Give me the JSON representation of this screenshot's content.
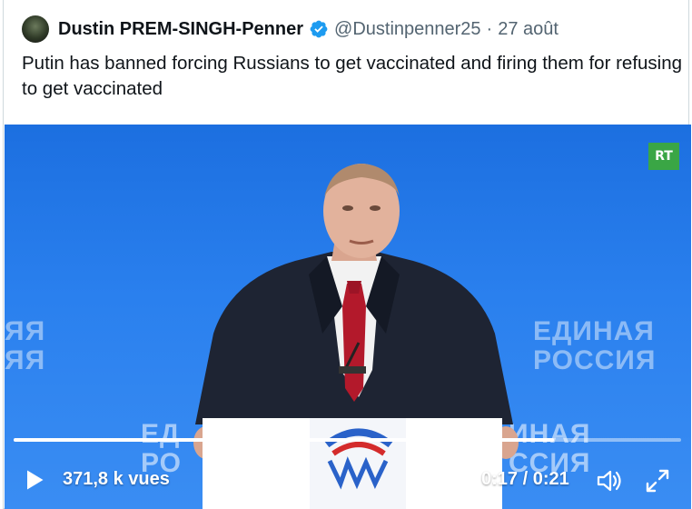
{
  "tweet": {
    "author_name": "Dustin PREM-SINGH-Penner",
    "handle": "@Dustinpenner25",
    "separator": "·",
    "date": "27 août",
    "text": "Putin has banned forcing Russians to get vaccinated and firing them for refusing to get vaccinated"
  },
  "video": {
    "views": "371,8 k vues",
    "time": "0:17 / 0:21",
    "progress": 0.81,
    "channel_logo": "RT",
    "background_text_right_1": "ЕДИНАЯ",
    "background_text_right_2": "РОССИЯ",
    "background_text_left_1": "ЯЯ",
    "background_text_left_2": "ЯЯ",
    "podium_text_left_1": "ЕД",
    "podium_text_left_2": "РО",
    "podium_text_right_1": "ИНАЯ",
    "podium_text_right_2": "ССИЯ"
  },
  "icons": {
    "verified": "verified-badge-icon",
    "play": "play-icon",
    "volume": "volume-icon",
    "fullscreen": "fullscreen-icon"
  },
  "colors": {
    "verified": "#1d9bf0",
    "text": "#0f1419",
    "secondary": "#536471",
    "stage_blue": "#2a80ee"
  }
}
